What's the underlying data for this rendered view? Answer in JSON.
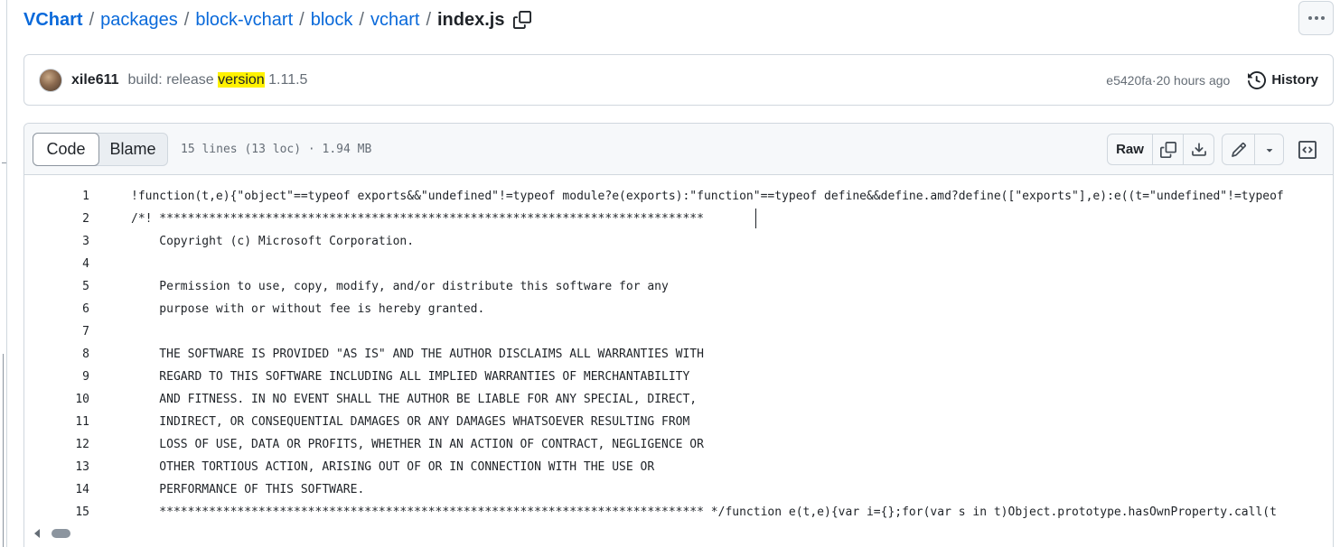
{
  "breadcrumb": {
    "repo": "VChart",
    "segments": [
      "packages",
      "block-vchart",
      "block",
      "vchart"
    ],
    "separator": "/",
    "current_file": "index.js"
  },
  "commit": {
    "author": "xile611",
    "message_prefix": "build: release ",
    "message_highlight": "version",
    "message_suffix": " 1.11.5",
    "hash": "e5420fa",
    "time_sep": " · ",
    "time": "20 hours ago",
    "history_label": "History"
  },
  "file_header": {
    "tabs": [
      "Code",
      "Blame"
    ],
    "active_tab": "Code",
    "meta": "15 lines (13 loc) · 1.94 MB",
    "raw_label": "Raw"
  },
  "icons": {
    "copy_path": "copy-icon",
    "more": "kebab-horizontal-icon",
    "history": "history-icon",
    "copy_raw": "copy-icon",
    "download": "download-icon",
    "edit": "pencil-icon",
    "edit_dropdown": "triangle-down-icon",
    "symbols": "code-square-icon"
  },
  "colors": {
    "link": "#0969da",
    "highlight": "#fff200",
    "muted": "#656d76",
    "border": "#d0d7de"
  },
  "code_lines": [
    {
      "n": "1",
      "text": "!function(t,e){\"object\"==typeof exports&&\"undefined\"!=typeof module?e(exports):\"function\"==typeof define&&define.amd?define([\"exports\"],e):e((t=\"undefined\"!=typeof"
    },
    {
      "n": "2",
      "text": "/*! *****************************************************************************"
    },
    {
      "n": "3",
      "text": "    Copyright (c) Microsoft Corporation."
    },
    {
      "n": "4",
      "text": ""
    },
    {
      "n": "5",
      "text": "    Permission to use, copy, modify, and/or distribute this software for any"
    },
    {
      "n": "6",
      "text": "    purpose with or without fee is hereby granted."
    },
    {
      "n": "7",
      "text": ""
    },
    {
      "n": "8",
      "text": "    THE SOFTWARE IS PROVIDED \"AS IS\" AND THE AUTHOR DISCLAIMS ALL WARRANTIES WITH"
    },
    {
      "n": "9",
      "text": "    REGARD TO THIS SOFTWARE INCLUDING ALL IMPLIED WARRANTIES OF MERCHANTABILITY"
    },
    {
      "n": "10",
      "text": "    AND FITNESS. IN NO EVENT SHALL THE AUTHOR BE LIABLE FOR ANY SPECIAL, DIRECT,"
    },
    {
      "n": "11",
      "text": "    INDIRECT, OR CONSEQUENTIAL DAMAGES OR ANY DAMAGES WHATSOEVER RESULTING FROM"
    },
    {
      "n": "12",
      "text": "    LOSS OF USE, DATA OR PROFITS, WHETHER IN AN ACTION OF CONTRACT, NEGLIGENCE OR"
    },
    {
      "n": "13",
      "text": "    OTHER TORTIOUS ACTION, ARISING OUT OF OR IN CONNECTION WITH THE USE OR"
    },
    {
      "n": "14",
      "text": "    PERFORMANCE OF THIS SOFTWARE."
    },
    {
      "n": "15",
      "text": "    ***************************************************************************** */function e(t,e){var i={};for(var s in t)Object.prototype.hasOwnProperty.call(t"
    }
  ]
}
